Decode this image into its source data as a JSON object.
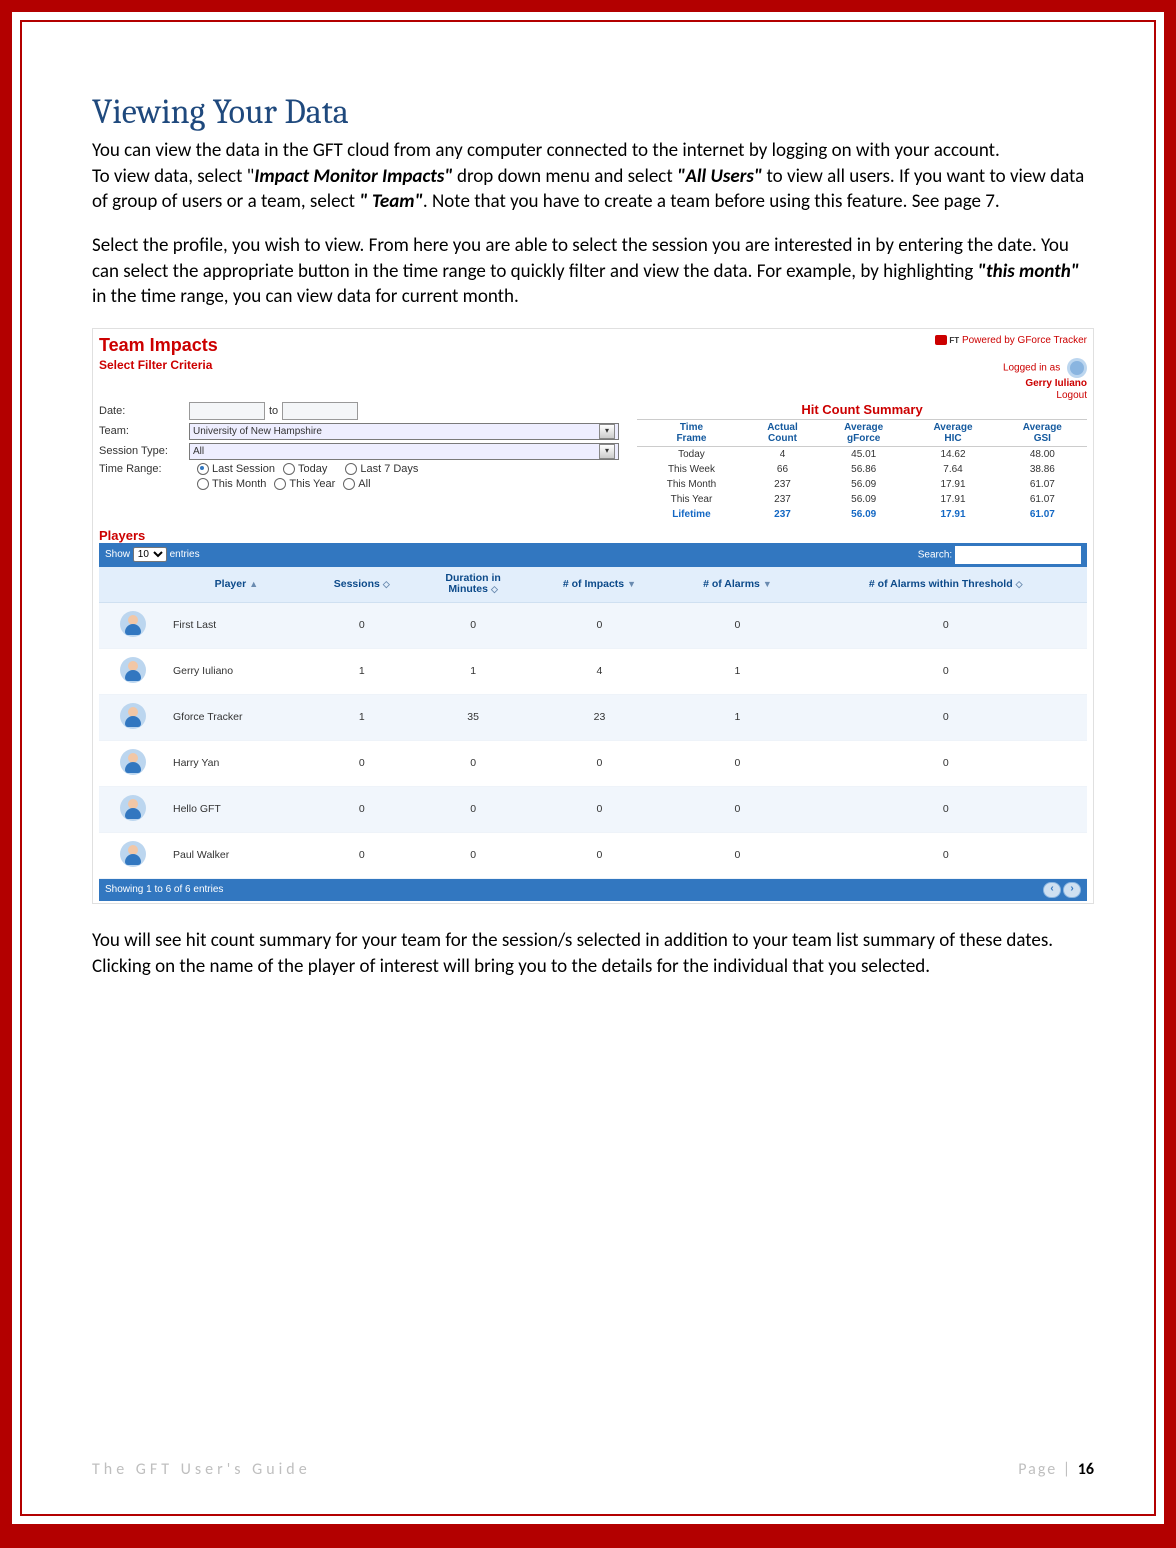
{
  "title": "Viewing Your Data",
  "para1a": "You can view the data in the GFT cloud from any computer connected to the internet by logging on with your account.",
  "para1b_a": "To view data, select  \"",
  "para1b_bi1": "Impact Monitor Impacts\"",
  "para1b_b": " drop down menu and select ",
  "para1b_bi2": "\"All Users\"",
  "para1b_c": " to view all users.  If you want to view data of group of users or a team, select ",
  "para1b_bi3": "\" Team\"",
  "para1b_d": ". Note that you have to create a team before using this feature. See page 7.",
  "para2_a": "Select the profile, you wish to view. From here you are able to select the session you are interested in by entering the date. You can select the appropriate button in the time range to quickly filter and view the data. For example, by highlighting  ",
  "para2_bi": "\"this month\"",
  "para2_b": " in the time range, you can view data for current month.",
  "shot": {
    "title": "Team Impacts",
    "powered": "Powered by GForce Tracker",
    "logged_as": "Logged in as",
    "logged_name": "Gerry Iuliano",
    "logout": "Logout",
    "filter_title": "Select Filter Criteria",
    "labels": {
      "date": "Date:",
      "to": "to",
      "team": "Team:",
      "session": "Session Type:",
      "range": "Time Range:"
    },
    "team_value": "University of New Hampshire",
    "session_value": "All",
    "ranges": {
      "last_session": "Last Session",
      "today": "Today",
      "last7": "Last 7 Days",
      "this_month": "This Month",
      "this_year": "This Year",
      "all": "All"
    },
    "summary_title": "Hit Count Summary",
    "summary_headers": {
      "time": "Time\nFrame",
      "actual": "Actual\nCount",
      "gforce": "Average\ngForce",
      "hic": "Average\nHIC",
      "gsi": "Average\nGSI"
    },
    "summary_rows": [
      {
        "t": "Today",
        "c": "4",
        "g": "45.01",
        "h": "14.62",
        "s": "48.00",
        "hl": false
      },
      {
        "t": "This Week",
        "c": "66",
        "g": "56.86",
        "h": "7.64",
        "s": "38.86",
        "hl": false
      },
      {
        "t": "This Month",
        "c": "237",
        "g": "56.09",
        "h": "17.91",
        "s": "61.07",
        "hl": false
      },
      {
        "t": "This Year",
        "c": "237",
        "g": "56.09",
        "h": "17.91",
        "s": "61.07",
        "hl": false
      },
      {
        "t": "Lifetime",
        "c": "237",
        "g": "56.09",
        "h": "17.91",
        "s": "61.07",
        "hl": true
      }
    ],
    "players_label": "Players",
    "show_a": "Show",
    "show_n": "10",
    "show_b": "entries",
    "search": "Search:",
    "cols": {
      "player": "Player",
      "sessions": "Sessions",
      "duration": "Duration in\nMinutes",
      "impacts": "# of Impacts",
      "alarms": "# of Alarms",
      "thresh": "# of Alarms within Threshold"
    },
    "rows": [
      {
        "p": "First Last",
        "s": "0",
        "d": "0",
        "i": "0",
        "a": "0",
        "t": "0",
        "alt": true
      },
      {
        "p": "Gerry Iuliano",
        "s": "1",
        "d": "1",
        "i": "4",
        "a": "1",
        "t": "0",
        "alt": false
      },
      {
        "p": "Gforce Tracker",
        "s": "1",
        "d": "35",
        "i": "23",
        "a": "1",
        "t": "0",
        "alt": true
      },
      {
        "p": "Harry Yan",
        "s": "0",
        "d": "0",
        "i": "0",
        "a": "0",
        "t": "0",
        "alt": false
      },
      {
        "p": "Hello GFT",
        "s": "0",
        "d": "0",
        "i": "0",
        "a": "0",
        "t": "0",
        "alt": true
      },
      {
        "p": "Paul Walker",
        "s": "0",
        "d": "0",
        "i": "0",
        "a": "0",
        "t": "0",
        "alt": false
      }
    ],
    "foot": "Showing 1 to 6 of 6 entries"
  },
  "para3a": "You will see hit count summary for your team for the session/s selected in addition to your team list summary of these dates.",
  "para3b": "Clicking on the name of the player of interest will bring you to the details for the individual that you selected.",
  "footer_left": "The GFT User's Guide",
  "footer_right_a": "Page | ",
  "footer_right_b": "16"
}
